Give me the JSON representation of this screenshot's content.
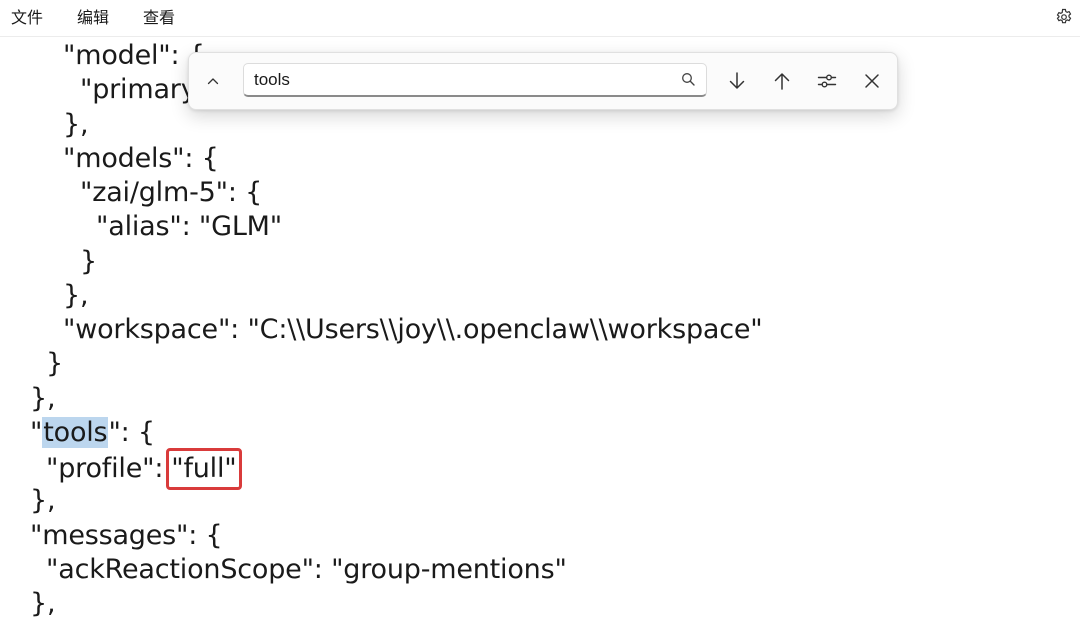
{
  "menu": {
    "file": "文件",
    "edit": "编辑",
    "view": "查看"
  },
  "icons": {
    "settings": "gear-icon",
    "collapse": "chevron-up-icon",
    "search": "search-icon",
    "next": "arrow-down-icon",
    "prev": "arrow-up-icon",
    "options": "sliders-icon",
    "close": "close-icon"
  },
  "find": {
    "query": "tools"
  },
  "editor": {
    "lines": [
      "\"model\": {",
      "\"primary",
      "},",
      "\"models\": {",
      "\"zai/glm-5\": {",
      "\"alias\": \"GLM\"",
      "}",
      "},",
      "\"workspace\": \"C:\\\\Users\\\\joy\\\\.openclaw\\\\workspace\"",
      "}",
      "},",
      "\"",
      "tools",
      "\": {",
      "\"profile\":",
      "\"full\"",
      "},",
      "\"messages\": {",
      "\"ackReactionScope\": \"group-mentions\"",
      "},"
    ]
  },
  "colors": {
    "search_highlight": "#bcd6ee",
    "annotation_box": "#d93b3b"
  }
}
